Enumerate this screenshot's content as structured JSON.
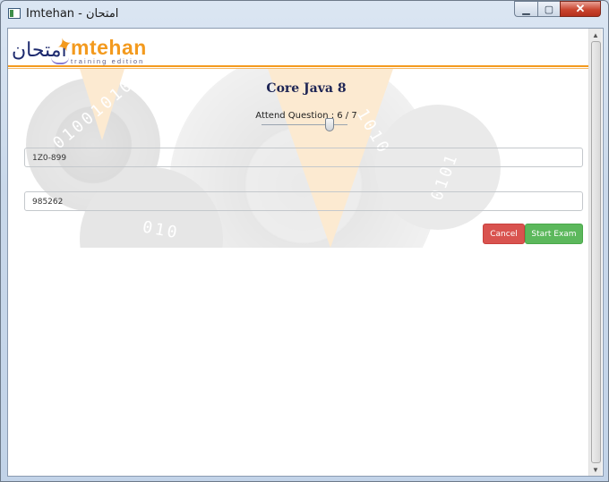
{
  "window": {
    "title": "Imtehan - امتحان",
    "minimize_glyph": "▁",
    "maximize_glyph": "▢",
    "close_glyph": "✕"
  },
  "logo": {
    "arabic": "امتحان",
    "name": "mtehan",
    "tagline": "training edition"
  },
  "exam": {
    "title": "Core Java 8",
    "attend_label": "Attend Question : 6 / 7",
    "question_current": 6,
    "question_total": 7
  },
  "fields": {
    "exam_code": "1Z0-899",
    "candidate_id": "985262"
  },
  "buttons": {
    "cancel": "Cancel",
    "start": "Start Exam"
  },
  "scrollbar": {
    "up_glyph": "▲",
    "down_glyph": "▼"
  },
  "background": {
    "bits_a": "01001010",
    "bits_b": "1010",
    "bits_c": "0101",
    "bits_d": "010"
  },
  "colors": {
    "accent": "#f39a1e",
    "cancel": "#d9534f",
    "start": "#5cb85c",
    "title": "#1d2454"
  }
}
